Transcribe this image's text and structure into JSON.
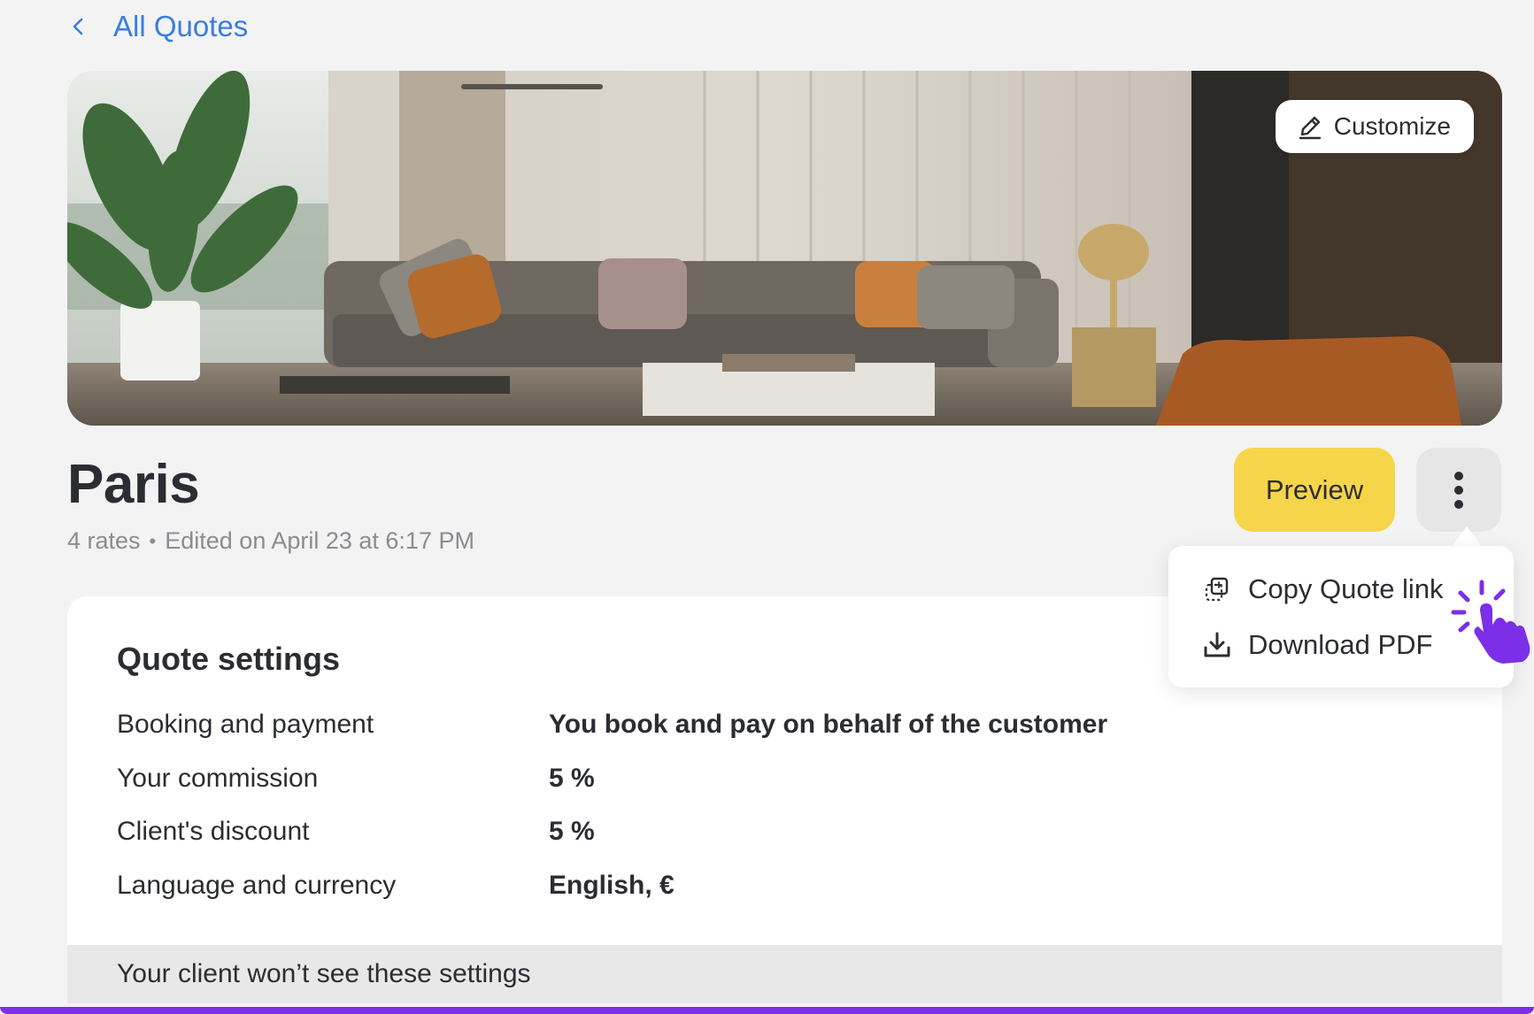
{
  "nav": {
    "back_label": "All Quotes"
  },
  "hero": {
    "customize_label": "Customize"
  },
  "quote": {
    "title": "Paris",
    "rates": "4 rates",
    "separator": "•",
    "edited": "Edited on April 23 at 6:17 PM"
  },
  "actions": {
    "preview_label": "Preview"
  },
  "menu": {
    "items": [
      {
        "label": "Copy Quote link",
        "icon": "copy-link-icon"
      },
      {
        "label": "Download PDF",
        "icon": "download-icon"
      }
    ]
  },
  "settings": {
    "title": "Quote settings",
    "rows": [
      {
        "label": "Booking and payment",
        "value": "You book and pay on behalf of the customer"
      },
      {
        "label": "Your commission",
        "value": "5 %"
      },
      {
        "label": "Client's discount",
        "value": "5 %"
      },
      {
        "label": "Language and currency",
        "value": "English, €"
      }
    ],
    "footer_note": "Your client won’t see these settings"
  },
  "colors": {
    "link": "#3a7de0",
    "preview_button": "#f7d54a",
    "accent": "#7c2ee8"
  }
}
